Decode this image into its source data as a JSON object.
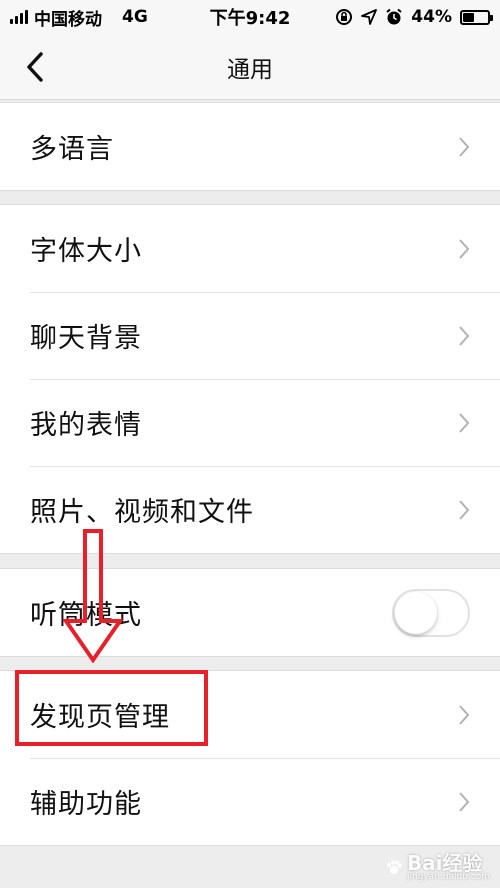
{
  "status_bar": {
    "carrier": "中国移动",
    "network": "4G",
    "time": "下午9:42",
    "battery_percent": "44%",
    "battery_level": 0.44
  },
  "nav": {
    "back_icon": "chevron-left-icon",
    "title": "通用"
  },
  "groups": [
    {
      "items": [
        {
          "label": "多语言",
          "accessory": "chevron"
        }
      ]
    },
    {
      "items": [
        {
          "label": "字体大小",
          "accessory": "chevron"
        },
        {
          "label": "聊天背景",
          "accessory": "chevron"
        },
        {
          "label": "我的表情",
          "accessory": "chevron"
        },
        {
          "label": "照片、视频和文件",
          "accessory": "chevron"
        }
      ]
    },
    {
      "items": [
        {
          "label": "听筒模式",
          "accessory": "toggle",
          "toggle_on": false
        }
      ]
    },
    {
      "items": [
        {
          "label": "发现页管理",
          "accessory": "chevron"
        },
        {
          "label": "辅助功能",
          "accessory": "chevron"
        }
      ]
    }
  ],
  "annotation": {
    "color": "#E8202A",
    "highlighted_item": "发现页管理"
  },
  "watermark": {
    "brand": "Bai经验",
    "url": "jingyan.baidu.com"
  },
  "colors": {
    "background": "#EDEDED",
    "cell": "#FFFFFF",
    "text": "#111111",
    "chevron": "#B2B2B2"
  }
}
